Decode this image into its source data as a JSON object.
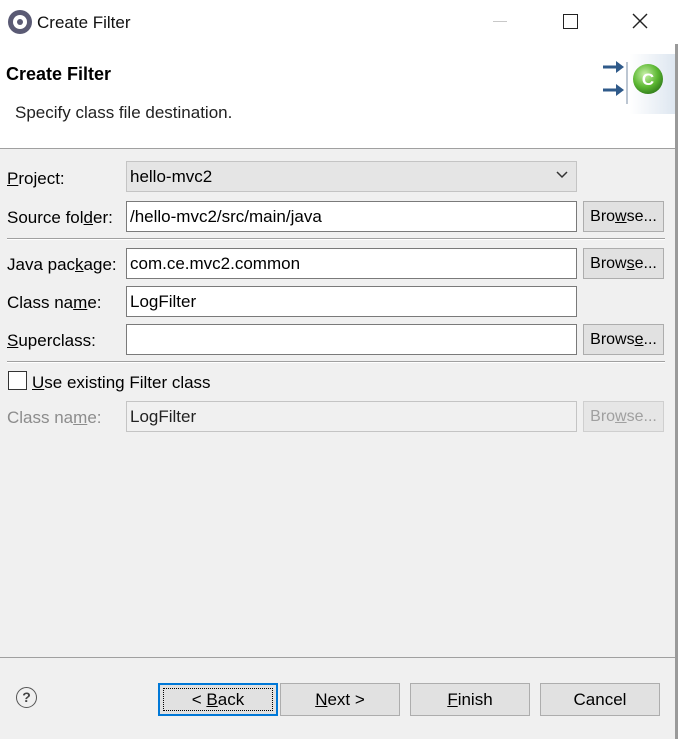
{
  "window": {
    "title": "Create Filter",
    "icon": "eclipse-icon",
    "controls": [
      "minimize-icon",
      "maximize-icon",
      "close-icon"
    ]
  },
  "banner": {
    "title": "Create Filter",
    "description": "Specify class file destination.",
    "icon": "new-class-wizard-icon"
  },
  "form": {
    "project": {
      "label_pre": "",
      "label_mn": "P",
      "label_post": "roject:",
      "value": "hello-mvc2"
    },
    "source_folder": {
      "label_pre": "Source fol",
      "label_mn": "d",
      "label_post": "er:",
      "value": "/hello-mvc2/src/main/java",
      "browse": {
        "pre": "Bro",
        "mn": "w",
        "post": "se..."
      }
    },
    "java_package": {
      "label_pre": "Java pac",
      "label_mn": "k",
      "label_post": "age:",
      "value": "com.ce.mvc2.common",
      "browse": {
        "pre": "Brow",
        "mn": "s",
        "post": "e..."
      }
    },
    "class_name": {
      "label_pre": "Class na",
      "label_mn": "m",
      "label_post": "e:",
      "value": "LogFilter"
    },
    "superclass": {
      "label_pre": "",
      "label_mn": "S",
      "label_post": "uperclass:",
      "value": "",
      "browse": {
        "pre": "Brows",
        "mn": "e",
        "post": "..."
      }
    },
    "use_existing": {
      "checked": false,
      "label_pre": "",
      "label_mn": "U",
      "label_post": "se existing Filter class"
    },
    "existing_class_name": {
      "label_pre": "Class na",
      "label_mn": "m",
      "label_post": "e:",
      "value": "LogFilter",
      "browse": {
        "pre": "Bro",
        "mn": "w",
        "post": "se..."
      },
      "enabled": false
    }
  },
  "footer": {
    "help_icon_glyph": "?",
    "back": {
      "pre": "< ",
      "mn": "B",
      "post": "ack"
    },
    "next": {
      "pre": "",
      "mn": "N",
      "post": "ext >"
    },
    "finish": {
      "pre": "",
      "mn": "F",
      "post": "inish"
    },
    "cancel": {
      "label": "Cancel"
    }
  },
  "colors": {
    "accent": "#0078d7",
    "banner_bg": "#ffffff",
    "dialog_bg": "#f0f0f0",
    "disabled_text": "#8c8c8c"
  }
}
